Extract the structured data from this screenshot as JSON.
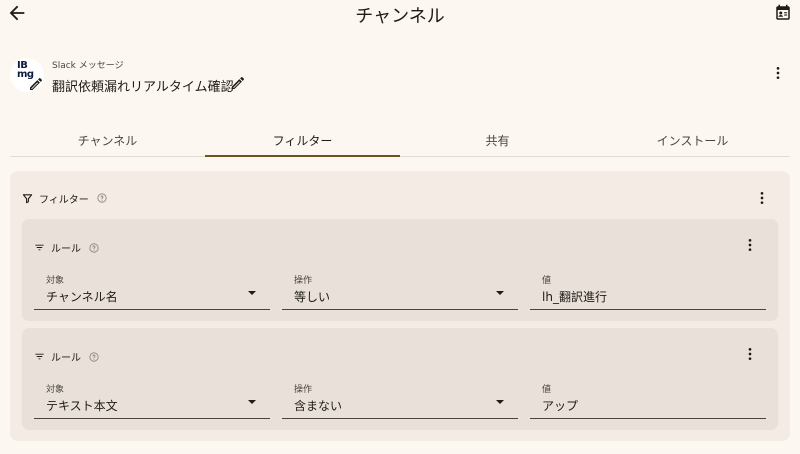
{
  "topbar": {
    "title": "チャンネル"
  },
  "app": {
    "logo_text_line1": "IB",
    "logo_text_line2": "mg",
    "subtitle": "Slack メッセージ",
    "name": "翻訳依頼漏れリアルタイム確認"
  },
  "tabs": [
    {
      "label": "チャンネル",
      "active": false
    },
    {
      "label": "フィルター",
      "active": true
    },
    {
      "label": "共有",
      "active": false
    },
    {
      "label": "インストール",
      "active": false
    }
  ],
  "filter": {
    "label": "フィルター",
    "rules": [
      {
        "label": "ルール",
        "target_label": "対象",
        "target_value": "チャンネル名",
        "op_label": "操作",
        "op_value": "等しい",
        "value_label": "値",
        "value_value": "lh_翻訳進行"
      },
      {
        "label": "ルール",
        "target_label": "対象",
        "target_value": "テキスト本文",
        "op_label": "操作",
        "op_value": "含まない",
        "value_label": "値",
        "value_value": "アップ"
      }
    ]
  },
  "icons": {
    "back": "arrow-left-icon",
    "contact": "contact-card-icon",
    "edit": "pencil-icon",
    "menu": "more-vert-icon",
    "filter": "funnel-icon",
    "rule": "filter-list-icon",
    "help": "help-circle-icon"
  },
  "colors": {
    "background": "#fdf7f2",
    "card": "#f3ebe4",
    "rule_card": "#e8e0d9",
    "tab_indicator": "#6b5520"
  }
}
